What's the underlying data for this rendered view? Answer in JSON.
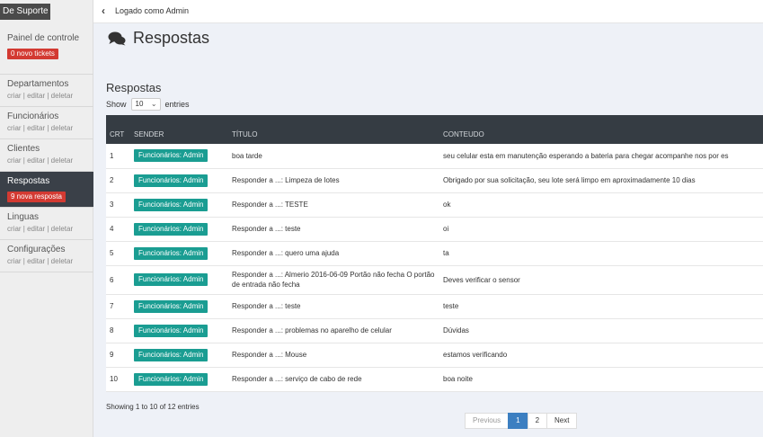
{
  "sidebar": {
    "brand": "De Suporte",
    "items": [
      {
        "label": "Painel de controle",
        "badge": "0 novo tickets"
      },
      {
        "label": "Departamentos",
        "links": [
          "criar",
          "editar",
          "deletar"
        ]
      },
      {
        "label": "Funcionários",
        "links": [
          "criar",
          "editar",
          "deletar"
        ]
      },
      {
        "label": "Clientes",
        "links": [
          "criar",
          "editar",
          "deletar"
        ]
      },
      {
        "label": "Respostas",
        "badge": "9 nova resposta",
        "active": true
      },
      {
        "label": "Linguas",
        "links": [
          "criar",
          "editar",
          "deletar"
        ]
      },
      {
        "label": "Configurações",
        "links": [
          "criar",
          "editar",
          "deletar"
        ]
      }
    ]
  },
  "topbar": {
    "collapse_icon": "‹",
    "logged_in_text": "Logado como Admin"
  },
  "page": {
    "title": "Respostas",
    "icon": "comments-icon"
  },
  "panel": {
    "title": "Respostas",
    "show_label": "Show",
    "entries_label": "entries",
    "length_value": "10",
    "columns": [
      "CRT",
      "SENDER",
      "TÍTULO",
      "CONTEUDO"
    ],
    "rows": [
      {
        "crt": "1",
        "sender": "Funcionários: Admin",
        "title": "boa tarde",
        "content": "seu celular esta em manutenção esperando a bateria para chegar acompanhe nos por es"
      },
      {
        "crt": "2",
        "sender": "Funcionários: Admin",
        "title": "Responder a ...: Limpeza de lotes",
        "content": "Obrigado por sua solicitação, seu lote será limpo em aproximadamente 10 dias"
      },
      {
        "crt": "3",
        "sender": "Funcionários: Admin",
        "title": "Responder a ...: TESTE",
        "content": "ok"
      },
      {
        "crt": "4",
        "sender": "Funcionários: Admin",
        "title": "Responder a ...: teste",
        "content": "oi"
      },
      {
        "crt": "5",
        "sender": "Funcionários: Admin",
        "title": "Responder a ...: quero uma ajuda",
        "content": "ta"
      },
      {
        "crt": "6",
        "sender": "Funcionários: Admin",
        "title": "Responder a ...: Almerio 2016-06-09 Portão não fecha O portão de entrada não fecha",
        "content": "Deves verificar o sensor"
      },
      {
        "crt": "7",
        "sender": "Funcionários: Admin",
        "title": "Responder a ...: teste",
        "content": "teste"
      },
      {
        "crt": "8",
        "sender": "Funcionários: Admin",
        "title": "Responder a ...: problemas no aparelho de celular",
        "content": "Dúvidas"
      },
      {
        "crt": "9",
        "sender": "Funcionários: Admin",
        "title": "Responder a ...: Mouse",
        "content": "estamos verificando"
      },
      {
        "crt": "10",
        "sender": "Funcionários: Admin",
        "title": "Responder a ...: serviço de cabo de rede",
        "content": "boa noite"
      }
    ],
    "info": "Showing 1 to 10 of 12 entries",
    "pagination": {
      "previous": "Previous",
      "pages": [
        "1",
        "2"
      ],
      "current": "1",
      "next": "Next"
    }
  },
  "colors": {
    "accent": "#3c7fc1",
    "badge_red": "#d33a32",
    "sender_teal": "#1a9d92",
    "header_dark": "#353c43"
  }
}
